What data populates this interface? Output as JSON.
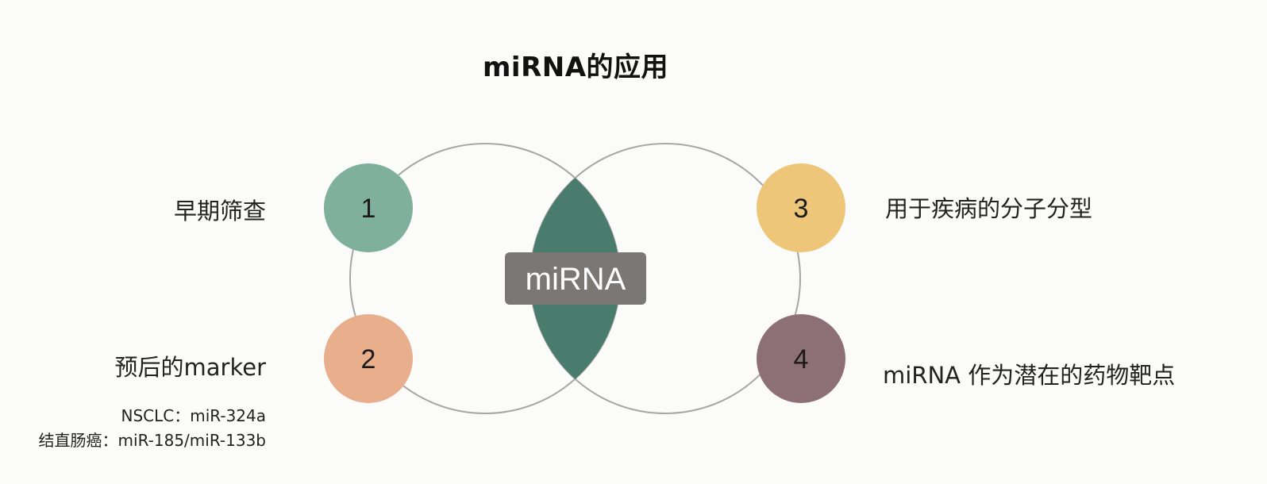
{
  "title": "miRNA的应用",
  "center_label": "miRNA",
  "nodes": [
    {
      "number": "1",
      "label": "早期筛查",
      "color": "#7fb09c"
    },
    {
      "number": "2",
      "label": "预后的marker",
      "color": "#e9ae8c"
    },
    {
      "number": "3",
      "label": "用于疾病的分子分型",
      "color": "#eec67a"
    },
    {
      "number": "4",
      "label": "miRNA 作为潜在的药物靶点",
      "color": "#8c6f77"
    }
  ],
  "notes": [
    "NSCLC：miR-324a",
    "结直肠癌：miR-185/miR-133b"
  ],
  "colors": {
    "intersection": "#4a7c6e",
    "center_box": "#7b7775",
    "ring": "#a6a6a6"
  }
}
